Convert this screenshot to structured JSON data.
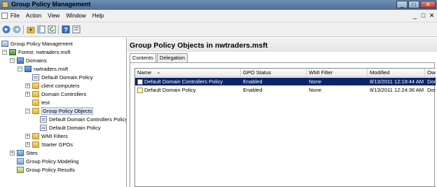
{
  "window": {
    "title": "Group Policy Management",
    "buttons": {
      "minimize": "_",
      "maximize": "□",
      "close": "✕"
    }
  },
  "menu": {
    "items": [
      "File",
      "Action",
      "View",
      "Window",
      "Help"
    ],
    "mdi_buttons": [
      "_",
      "□",
      "✕"
    ]
  },
  "toolbar": {
    "icons": [
      "back-arrow-icon",
      "forward-arrow-icon",
      "folder-up-icon",
      "show-hide-tree-icon",
      "refresh-icon",
      "help-icon",
      "properties-icon"
    ]
  },
  "tree": {
    "root": "Group Policy Management",
    "forest": "Forest: nwtraders.msft",
    "domains": "Domains",
    "domain": "nwtraders.msft",
    "domain_children": [
      "Default Domain Policy",
      "client computers",
      "Domain Controllers",
      "test"
    ],
    "gpo_container": "Group Policy Objects",
    "gpo_children": [
      "Default Domain Controllers Policy",
      "Default Domain Policy"
    ],
    "wmi_filters": "WMI Filters",
    "starter_gpos": "Starter GPOs",
    "sites": "Sites",
    "modeling": "Group Policy Modeling",
    "results": "Group Policy Results"
  },
  "details": {
    "title": "Group Policy Objects in nwtraders.msft",
    "tabs": [
      "Contents",
      "Delegation"
    ],
    "columns": [
      "Name",
      "GPO Status",
      "WMI Filter",
      "Modified",
      "Owner"
    ],
    "rows": [
      {
        "name": "Default Domain Controllers Policy",
        "status": "Enabled",
        "wmi": "None",
        "modified": "8/13/2011 12:19:44 AM",
        "owner": "Domai",
        "selected": true
      },
      {
        "name": "Default Domain Policy",
        "status": "Enabled",
        "wmi": "None",
        "modified": "8/13/2011 12:24:36 AM",
        "owner": "Domai",
        "selected": false
      }
    ]
  },
  "colors": {
    "selection": "#0a246a",
    "titlebar": "#5a7ba6"
  }
}
